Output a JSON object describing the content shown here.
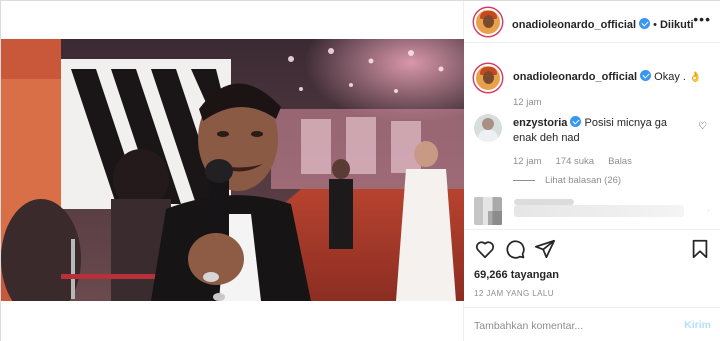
{
  "header": {
    "username": "onadioleonardo_official",
    "separator": "•",
    "follow_status": "Diikuti",
    "more_icon": "more-icon"
  },
  "caption": {
    "username": "onadioleonardo_official",
    "text": "Okay .",
    "emoji": "👌",
    "time": "12 jam"
  },
  "comments": [
    {
      "username": "enzystoria",
      "text_line1": "Posisi micnya ga",
      "text_line2": "enak deh nad",
      "time": "12 jam",
      "likes": "174 suka",
      "reply": "Balas",
      "view_replies": "Lihat balasan (26)"
    }
  ],
  "actions": {
    "like_icon": "heart-icon",
    "comment_icon": "comment-icon",
    "share_icon": "share-icon",
    "save_icon": "bookmark-icon"
  },
  "stats": {
    "views": "69,266 tayangan",
    "posted": "12 JAM YANG LALU"
  },
  "add_comment": {
    "placeholder": "Tambahkan komentar...",
    "post_label": "Kirim"
  },
  "colors": {
    "verified": "#3897f0",
    "post_button_disabled": "#b2dffc",
    "secondary_text": "#8e8e8e",
    "carpet_red": "#c8432e"
  }
}
